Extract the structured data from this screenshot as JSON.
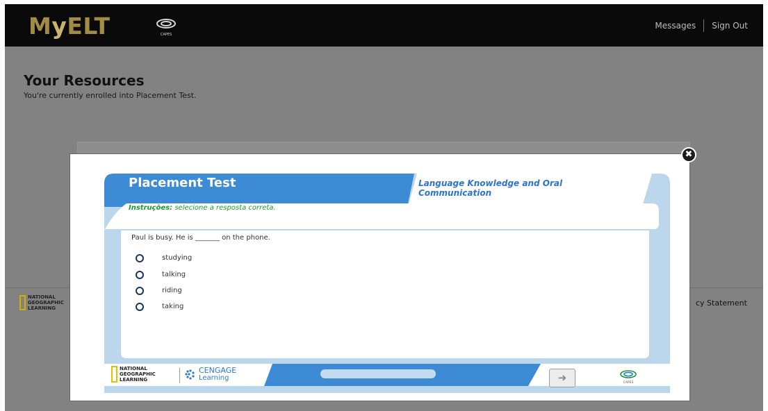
{
  "header": {
    "logo_prefix": "M",
    "logo_y": "y",
    "logo_rest": "ELT",
    "partner_logo": "CAPES",
    "nav": {
      "messages": "Messages",
      "sign_out": "Sign Out"
    }
  },
  "page": {
    "title": "Your Resources",
    "subtitle": "You're currently enrolled into Placement Test.",
    "footer_left_logo": [
      "NATIONAL",
      "GEOGRAPHIC",
      "LEARNING"
    ],
    "footer_right_link": "cy Statement"
  },
  "modal": {
    "close_icon": "close-icon",
    "title": "Placement Test",
    "section": "Language Knowledge and Oral Communication",
    "instructions_label": "Instruções:",
    "instructions_text": "selecione a resposta correta.",
    "question": "Paul is busy. He is _______ on the phone.",
    "options": [
      {
        "label": "studying"
      },
      {
        "label": "talking"
      },
      {
        "label": "riding"
      },
      {
        "label": "taking"
      }
    ],
    "footer": {
      "ng_logo": [
        "NATIONAL",
        "GEOGRAPHIC",
        "LEARNING"
      ],
      "cengage_line1": "CENGAGE",
      "cengage_line2": "Learning",
      "next_icon": "arrow-right-icon",
      "capes_logo": "CAPES"
    }
  },
  "colors": {
    "accent_blue": "#3d8bd4",
    "light_blue": "#bcd6ec",
    "instructions_green": "#1a9a2e",
    "logo_gold": "#a08c45"
  }
}
